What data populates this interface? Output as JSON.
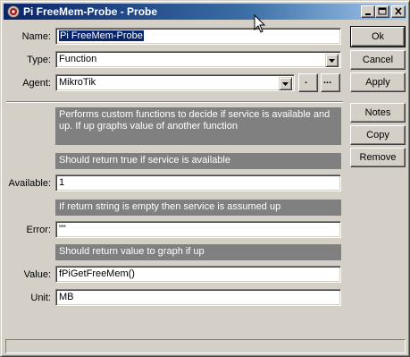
{
  "window": {
    "title": "Pi FreeMem-Probe - Probe"
  },
  "title_buttons": {
    "minimize": "minimize-icon",
    "maximize": "maximize-icon",
    "close": "close-icon"
  },
  "form": {
    "name": {
      "label": "Name:",
      "value": "Pi FreeMem-Probe"
    },
    "type": {
      "label": "Type:",
      "value": "Function"
    },
    "agent": {
      "label": "Agent:",
      "value": "MikroTik",
      "btn1": ".",
      "btn2": "..."
    },
    "description": "Performs custom functions to decide if service is available and up. If up graphs value of another function",
    "available_hint": "Should return true if service is available",
    "available": {
      "label": "Available:",
      "value": "1"
    },
    "error_hint": "If return string is empty then service is assumed up",
    "error": {
      "label": "Error:",
      "value": "\"\""
    },
    "value_hint": "Should return value to graph if up",
    "value": {
      "label": "Value:",
      "value": "fPiGetFreeMem()"
    },
    "unit": {
      "label": "Unit:",
      "value": "MB"
    }
  },
  "buttons": {
    "ok": "Ok",
    "cancel": "Cancel",
    "apply": "Apply",
    "notes": "Notes",
    "copy": "Copy",
    "remove": "Remove"
  },
  "colors": {
    "title_bar": "#0a246a",
    "face": "#d4d0c8",
    "info_bar": "#808080"
  }
}
